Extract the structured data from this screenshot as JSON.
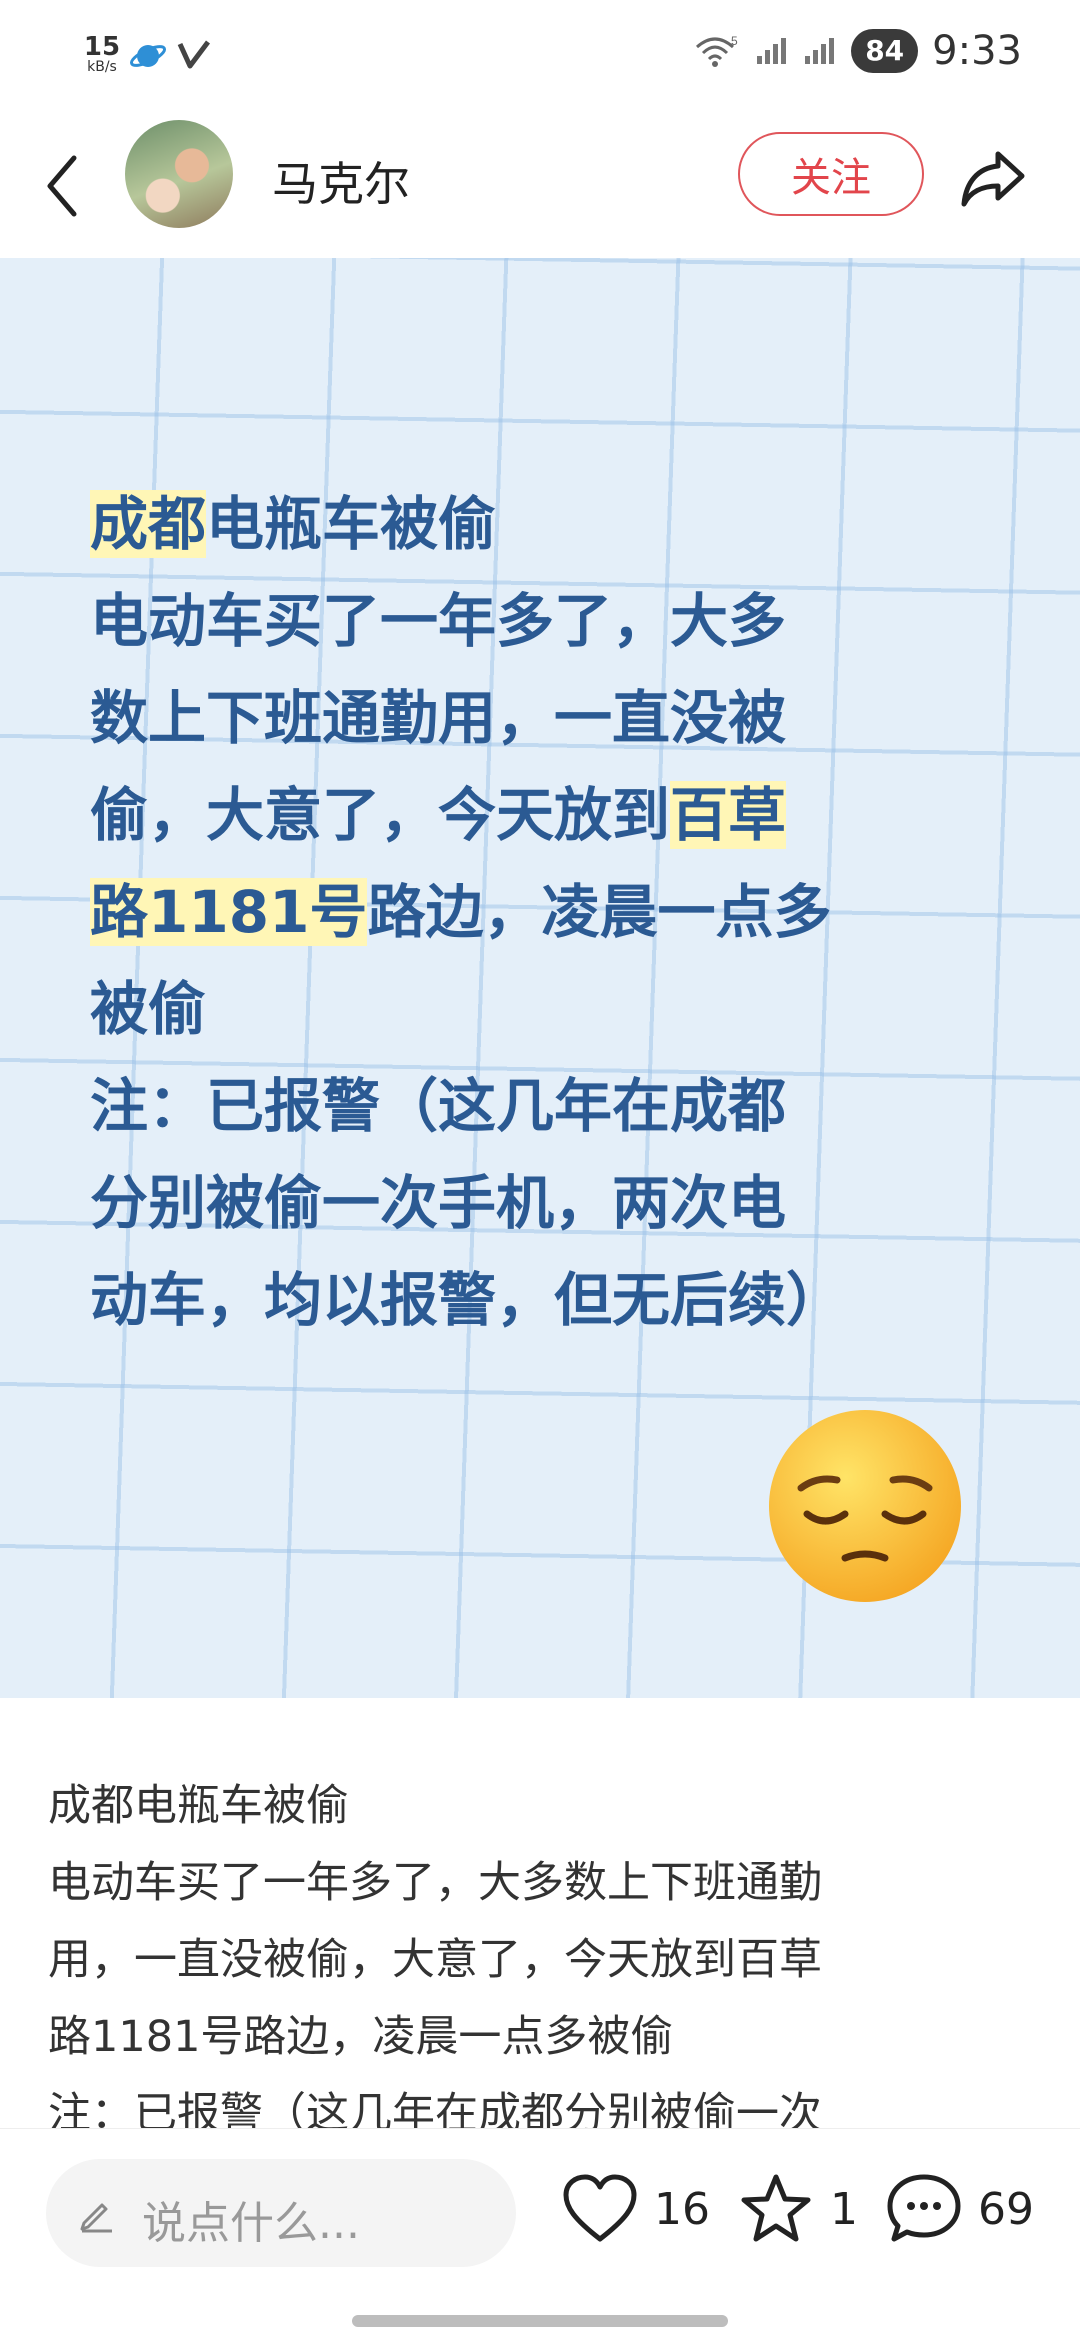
{
  "status_bar": {
    "speed_value": "15",
    "speed_unit": "kB/s",
    "network": "5",
    "battery": "84",
    "time": "9:33",
    "icons": [
      "planet-app-icon",
      "v-app-icon",
      "wifi-icon",
      "signal-icon",
      "signal-icon"
    ]
  },
  "header": {
    "username": "马克尔",
    "follow_label": "关注",
    "icons": [
      "back-arrow-icon",
      "share-icon"
    ]
  },
  "hero": {
    "lines": [
      {
        "pre": "",
        "hl": "成都",
        "post": "电瓶车被偷"
      },
      {
        "pre": "电动车买了一年多了，大多",
        "hl": "",
        "post": ""
      },
      {
        "pre": "数上下班通勤用，一直没被",
        "hl": "",
        "post": ""
      },
      {
        "pre": "偷，大意了，今天放到",
        "hl": "百草",
        "post": ""
      },
      {
        "pre": "",
        "hl": "路1181号",
        "post": "路边，凌晨一点多"
      },
      {
        "pre": "被偷",
        "hl": "",
        "post": ""
      },
      {
        "pre": "注：已报警（这几年在成都",
        "hl": "",
        "post": ""
      },
      {
        "pre": "分别被偷一次手机，两次电",
        "hl": "",
        "post": ""
      },
      {
        "pre": "动车，均以报警，但无后续）",
        "hl": "",
        "post": ""
      }
    ],
    "emoji": "pensive-face"
  },
  "body": {
    "lines": [
      "成都电瓶车被偷",
      "电动车买了一年多了，大多数上下班通勤",
      "用，一直没被偷，大意了，今天放到百草",
      "路1181号路边，凌晨一点多被偷",
      "注：已报警（这几年在成都分别被偷一次"
    ]
  },
  "bottom_bar": {
    "comment_placeholder": "说点什么...",
    "likes": "16",
    "favorites": "1",
    "comments": "69"
  },
  "colors": {
    "accent_red": "#e2454b",
    "hero_text": "#2b5a93",
    "highlight": "#fff6b6",
    "hero_bg": "#e4eff9"
  }
}
